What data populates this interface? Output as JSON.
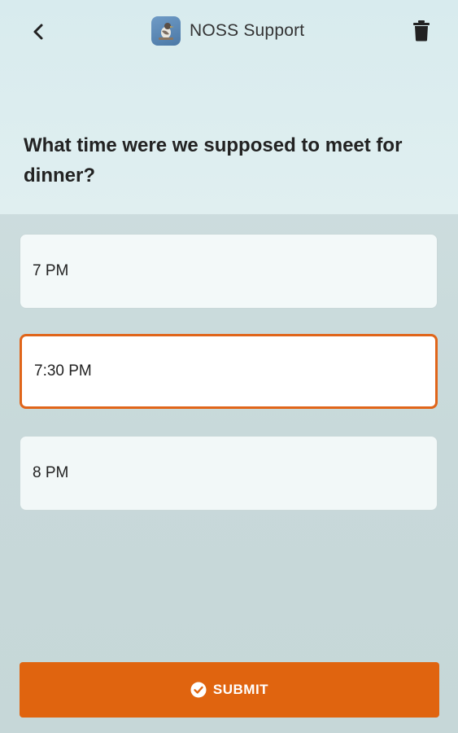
{
  "header": {
    "title": "NOSS Support",
    "back_icon": "chevron-left-icon",
    "delete_icon": "trash-icon",
    "logo_icon": "bird-logo-icon"
  },
  "question": {
    "text": "What time were we supposed to meet for dinner?"
  },
  "options": [
    {
      "label": "7 PM",
      "selected": false
    },
    {
      "label": "7:30 PM",
      "selected": true
    },
    {
      "label": "8 PM",
      "selected": false
    }
  ],
  "submit": {
    "label": "SUBMIT",
    "icon": "check-circle-icon"
  },
  "colors": {
    "accent": "#e0640f",
    "selected_border": "#e0651a",
    "text": "#222222"
  }
}
